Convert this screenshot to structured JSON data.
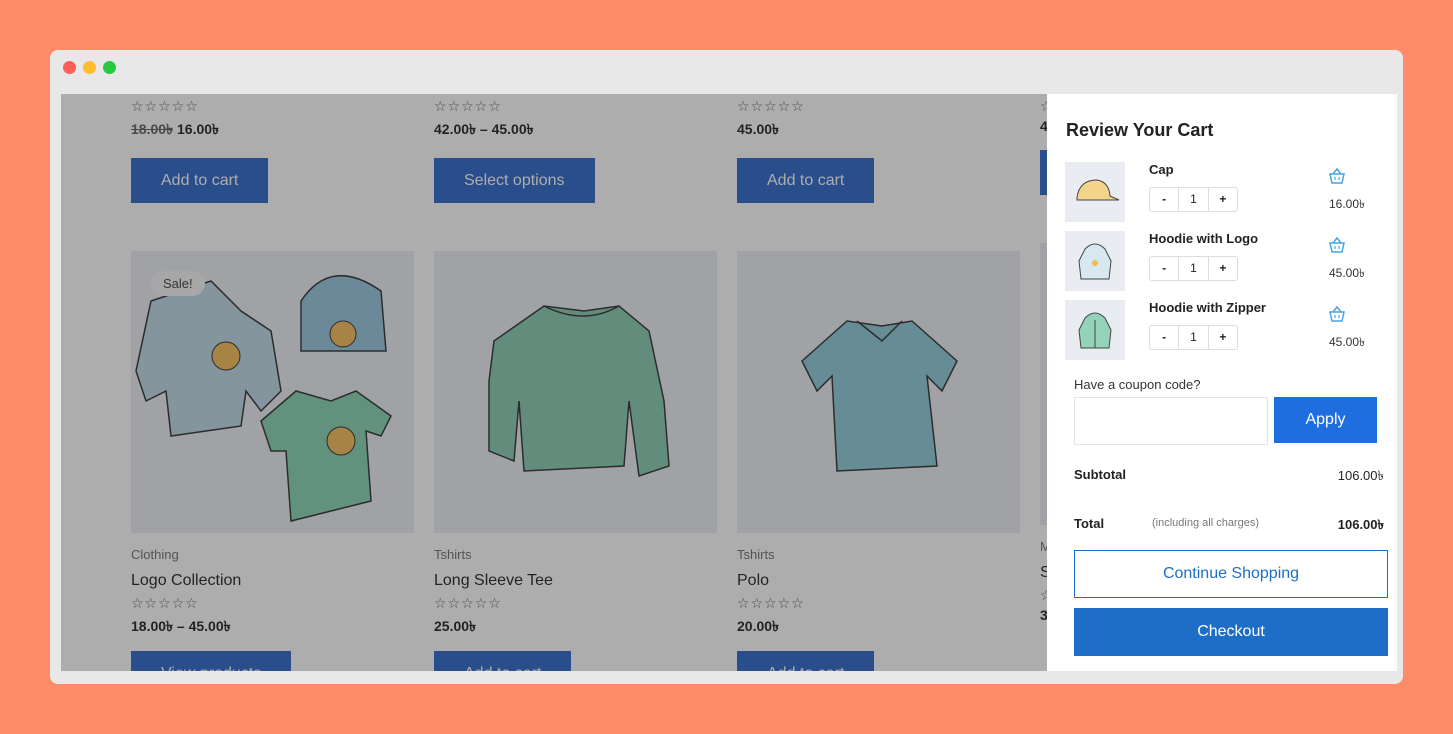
{
  "shop": {
    "top_row": [
      {
        "old_price": "18.00৳",
        "price": "16.00৳",
        "button": "Add to cart"
      },
      {
        "old_price": "",
        "price": "42.00৳ – 45.00৳",
        "button": "Select options"
      },
      {
        "old_price": "",
        "price": "45.00৳",
        "button": "Add to cart"
      }
    ],
    "products": [
      {
        "category": "Clothing",
        "name": "Logo Collection",
        "price": "18.00৳ – 45.00৳",
        "button": "View products",
        "badge": "Sale!"
      },
      {
        "category": "Tshirts",
        "name": "Long Sleeve Tee",
        "price": "25.00৳",
        "button": "Add to cart"
      },
      {
        "category": "Tshirts",
        "name": "Polo",
        "price": "20.00৳",
        "button": "Add to cart"
      },
      {
        "category": "M",
        "name": "S",
        "price": "3"
      }
    ],
    "stars": "☆☆☆☆☆"
  },
  "cart": {
    "title": "Review Your Cart",
    "items": [
      {
        "name": "Cap",
        "qty": "1",
        "price": "16.00৳",
        "minus": "-",
        "plus": "+"
      },
      {
        "name": "Hoodie with Logo",
        "qty": "1",
        "price": "45.00৳",
        "minus": "-",
        "plus": "+"
      },
      {
        "name": "Hoodie with Zipper",
        "qty": "1",
        "price": "45.00৳",
        "minus": "-",
        "plus": "+"
      }
    ],
    "coupon_label": "Have a coupon code?",
    "coupon_placeholder": "",
    "apply": "Apply",
    "subtotal_label": "Subtotal",
    "subtotal": "106.00৳",
    "total_label": "Total",
    "total_note": "(including all charges)",
    "total": "106.00৳",
    "continue": "Continue Shopping",
    "checkout": "Checkout"
  },
  "colors": {
    "background": "#ff8c69",
    "button_blue": "#1e5bc6",
    "cart_blue": "#1e6ec7"
  }
}
